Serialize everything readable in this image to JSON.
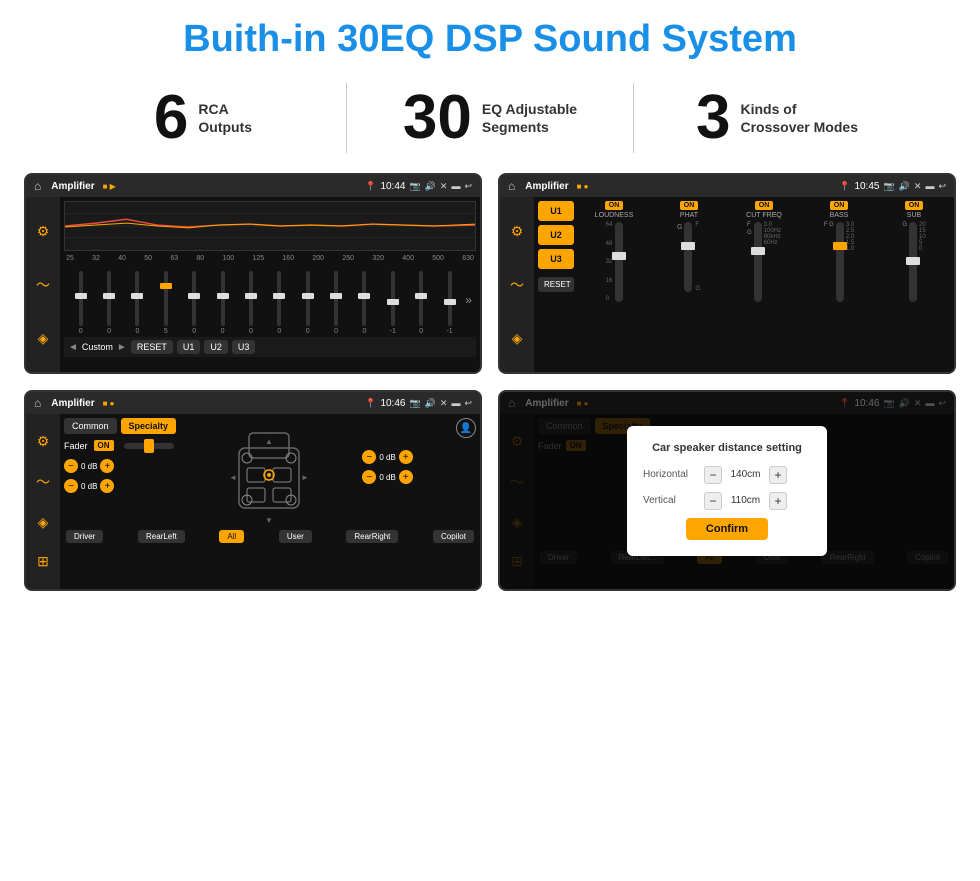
{
  "page": {
    "title": "Buith-in 30EQ DSP Sound System",
    "stats": [
      {
        "number": "6",
        "label": "RCA\nOutputs"
      },
      {
        "number": "30",
        "label": "EQ Adjustable\nSegments"
      },
      {
        "number": "3",
        "label": "Kinds of\nCrossover Modes"
      }
    ],
    "screens": [
      {
        "id": "eq-screen",
        "status_bar": {
          "title": "Amplifier",
          "time": "10:44"
        }
      },
      {
        "id": "amp2-screen",
        "status_bar": {
          "title": "Amplifier",
          "time": "10:45"
        }
      },
      {
        "id": "fader-screen",
        "status_bar": {
          "title": "Amplifier",
          "time": "10:46"
        }
      },
      {
        "id": "dialog-screen",
        "status_bar": {
          "title": "Amplifier",
          "time": "10:46"
        },
        "dialog": {
          "title": "Car speaker distance setting",
          "horizontal_label": "Horizontal",
          "horizontal_value": "140cm",
          "vertical_label": "Vertical",
          "vertical_value": "110cm",
          "confirm_label": "Confirm"
        }
      }
    ],
    "eq_labels": [
      "25",
      "32",
      "40",
      "50",
      "63",
      "80",
      "100",
      "125",
      "160",
      "200",
      "250",
      "320",
      "400",
      "500",
      "630"
    ],
    "eq_values": [
      "0",
      "0",
      "0",
      "5",
      "0",
      "0",
      "0",
      "0",
      "0",
      "0",
      "0",
      "-1",
      "0",
      "-1"
    ],
    "eq_presets": [
      "Custom",
      "RESET",
      "U1",
      "U2",
      "U3"
    ],
    "channels": [
      "LOUDNESS",
      "PHAT",
      "CUT FREQ",
      "BASS",
      "SUB"
    ],
    "channel_states": [
      "ON",
      "ON",
      "ON",
      "ON",
      "ON"
    ],
    "u_buttons": [
      "U1",
      "U2",
      "U3"
    ],
    "fader": {
      "tabs": [
        "Common",
        "Specialty"
      ],
      "label": "Fader",
      "on": "ON",
      "db_values": [
        "0 dB",
        "0 dB",
        "0 dB",
        "0 dB"
      ],
      "bottom_labels": [
        "Driver",
        "RearLeft",
        "All",
        "User",
        "RearRight",
        "Copilot"
      ]
    }
  }
}
